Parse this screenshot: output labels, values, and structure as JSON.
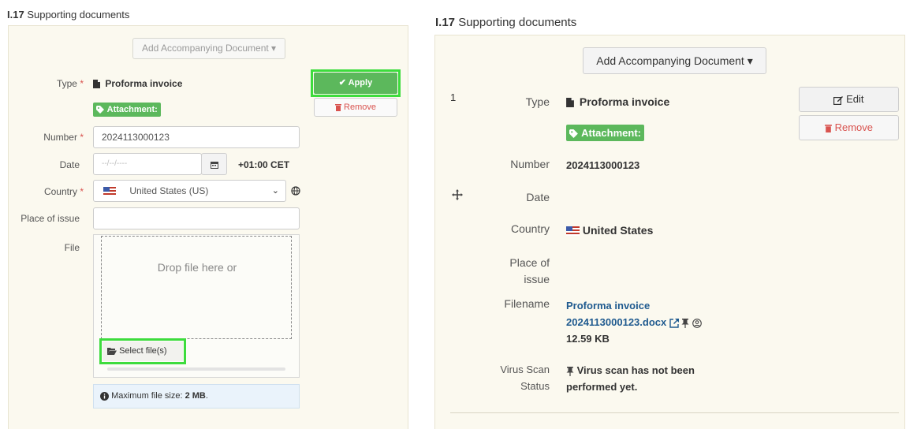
{
  "left": {
    "title_num": "I.17",
    "title_text": "Supporting documents",
    "add_doc_label": "Add Accompanying Document ▾",
    "type_label": "Type",
    "type_value": "Proforma invoice",
    "attachment_badge": "Attachment:",
    "apply_label": "✔ Apply",
    "remove_label": "Remove",
    "number_label": "Number",
    "number_value": "2024113000123",
    "date_label": "Date",
    "date_placeholder": "--/--/----",
    "timezone": "+01:00 CET",
    "country_label": "Country",
    "country_value": "United States (US)",
    "place_label": "Place of issue",
    "place_value": "",
    "file_label": "File",
    "drop_text": "Drop file here or",
    "select_files_label": "Select file(s)",
    "max_file_prefix": "Maximum file size:",
    "max_file_value": "2 MB",
    "required_mark": "*"
  },
  "right": {
    "title_num": "I.17",
    "title_text": "Supporting documents",
    "add_doc_label": "Add Accompanying Document ▾",
    "row_index": "1",
    "type_label": "Type",
    "type_value": "Proforma invoice",
    "attachment_badge": "Attachment:",
    "edit_label": "Edit",
    "remove_label": "Remove",
    "number_label": "Number",
    "number_value": "2024113000123",
    "date_label": "Date",
    "country_label": "Country",
    "country_value": "United States",
    "place_label_1": "Place of",
    "place_label_2": "issue",
    "filename_label": "Filename",
    "filename_line1": "Proforma invoice",
    "filename_line2": "2024113000123.docx",
    "file_size": "12.59 KB",
    "virus_label_1": "Virus Scan",
    "virus_label_2": "Status",
    "virus_line1": "Virus scan has not been",
    "virus_line2": "performed yet."
  },
  "icons": {
    "file": "file-icon",
    "tag": "tag-icon",
    "check": "check-icon",
    "trash": "trash-icon",
    "calendar": "calendar-icon",
    "globe": "globe-icon",
    "folder": "folder-open-icon",
    "info": "info-icon",
    "edit": "edit-icon",
    "move": "move-icon",
    "external_link": "external-link-icon",
    "pin": "pin-icon",
    "user_circle": "user-circle-icon"
  },
  "colors": {
    "success": "#5cb85c",
    "danger": "#d9534f",
    "highlight": "#3ddc3d",
    "link": "#1f5a8f",
    "panel_bg": "#fbf9ef",
    "info_bg": "#eaf3fb"
  }
}
